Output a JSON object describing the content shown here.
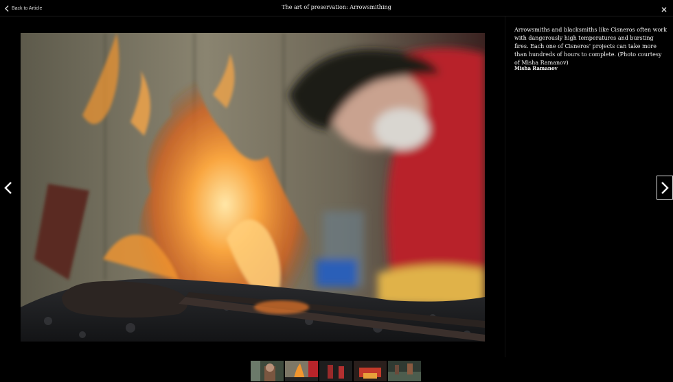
{
  "header": {
    "back_label": "Back to Article",
    "title": "The art of preservation: Arrowsmithing"
  },
  "photo": {
    "alt": "Arrowsmith working over a forge fire"
  },
  "caption": {
    "text": "Arrowsmiths and blacksmiths like Cisneros often work with dangerously high temperatures and bursting fires. Each one of Cisneros' projects can take more than hundreds of hours to complete. (Photo courtesy of Misha Ramanov)",
    "credit": "Misha Ramanov"
  },
  "colors": {
    "background": "#000000",
    "flame": "#f2962e",
    "shirt": "#b8242a"
  },
  "icons": {
    "back": "chevron-left-icon",
    "close": "close-icon",
    "prev": "chevron-left-icon",
    "next": "chevron-right-icon"
  }
}
